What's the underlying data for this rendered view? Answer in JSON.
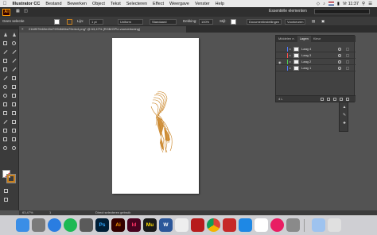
{
  "menubar": {
    "app_name": "Illustrator CC",
    "items": [
      "Bestand",
      "Bewerken",
      "Object",
      "Tekst",
      "Selecteren",
      "Effect",
      "Weergave",
      "Venster",
      "Help"
    ],
    "clock": "Vr 11:37"
  },
  "appbar": {
    "logo": "Ai",
    "workspace": "Essentiële elementen"
  },
  "controlbar": {
    "selection_label": "Geen selectie",
    "stroke_label": "Lijn:",
    "stroke_value": "1 pt",
    "profile_label": "Uniform",
    "brush_label": "Standaard",
    "opacity_label": "Dekking:",
    "opacity_value": "100%",
    "style_label": "Stijl:",
    "doc_settings": "Documentinstellingen",
    "preferences": "Voorkeuren",
    "stroke_color": "#c8801f"
  },
  "document": {
    "tab_title": "21fdf07fe69e45d79f94fd6ba79e4c4.png* @ 63,47% (RGB/GPU-voorvertoning)"
  },
  "layers_panel": {
    "tabs": [
      "Middelen e.",
      "Lagen",
      "Kleur"
    ],
    "layers": [
      {
        "name": "Laag 4",
        "color": "#4f7cff",
        "visible": false
      },
      {
        "name": "Laag 3",
        "color": "#ff4f4f",
        "visible": false
      },
      {
        "name": "Laag 2",
        "color": "#4fcf4f",
        "visible": true
      },
      {
        "name": "Laag 1",
        "color": "#4f7cff",
        "visible": false
      }
    ],
    "count": "4 L"
  },
  "statusbar": {
    "zoom": "63,47%",
    "page": "1",
    "status": "Direct selecteren gebruik"
  },
  "dock": {
    "apps": [
      {
        "label": "",
        "name": "finder",
        "color": "#3a8ee6"
      },
      {
        "label": "",
        "name": "launchpad",
        "color": "#7a7a7a"
      },
      {
        "label": "",
        "name": "safari",
        "color": "#2a7de1"
      },
      {
        "label": "",
        "name": "spotify",
        "color": "#1db954"
      },
      {
        "label": "",
        "name": "image-capture",
        "color": "#5a5a5a"
      },
      {
        "label": "Ps",
        "name": "photoshop",
        "color": "#001e36"
      },
      {
        "label": "Ai",
        "name": "illustrator",
        "color": "#330000"
      },
      {
        "label": "Id",
        "name": "indesign",
        "color": "#49021f"
      },
      {
        "label": "Mu",
        "name": "muse",
        "color": "#1a1a1a"
      },
      {
        "label": "W",
        "name": "word",
        "color": "#2b579a"
      },
      {
        "label": "",
        "name": "preview",
        "color": "#eeeeee"
      },
      {
        "label": "",
        "name": "filezilla",
        "color": "#b71c1c"
      },
      {
        "label": "",
        "name": "chrome",
        "color": "#ffffff"
      },
      {
        "label": "",
        "name": "photo-booth",
        "color": "#c62828"
      },
      {
        "label": "",
        "name": "app-store",
        "color": "#1e88e5"
      },
      {
        "label": "",
        "name": "calendar",
        "color": "#ffffff"
      },
      {
        "label": "",
        "name": "itunes",
        "color": "#e91e63"
      },
      {
        "label": "",
        "name": "system-preferences",
        "color": "#8a8a8a"
      },
      {
        "label": "",
        "name": "downloads",
        "color": "#9ec3ef"
      },
      {
        "label": "",
        "name": "trash",
        "color": "#e0e0e0"
      }
    ]
  }
}
